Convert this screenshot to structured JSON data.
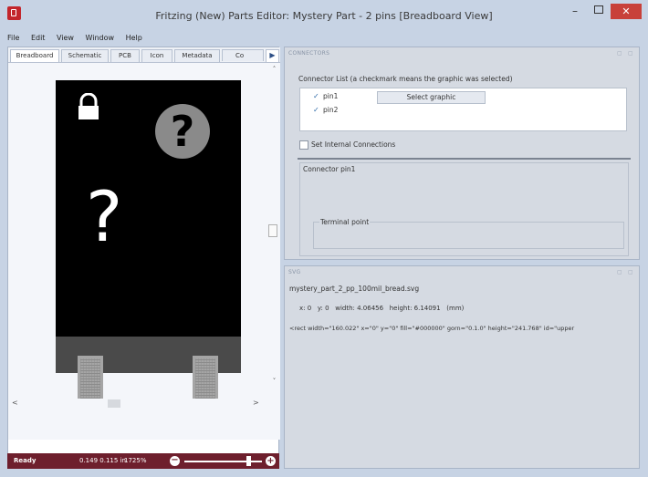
{
  "window": {
    "title": "Fritzing (New) Parts Editor: Mystery Part - 2 pins [Breadboard View]",
    "minimize_glyph": "–",
    "close_glyph": "✕"
  },
  "menubar": [
    "File",
    "Edit",
    "View",
    "Window",
    "Help"
  ],
  "tabs": [
    "Breadboard",
    "Schematic",
    "PCB",
    "Icon",
    "Metadata",
    "Connectors"
  ],
  "tabs_visible": [
    "Breadboard",
    "Schematic",
    "PCB",
    "Icon",
    "Metadata",
    "Co"
  ],
  "tab_scroll_glyph": "▶",
  "canvas": {
    "qmark_small": "?",
    "qmark_large": "?",
    "icons": [
      "lock-icon",
      "question-mark-icon"
    ],
    "vscroll_up": "˄",
    "vscroll_down": "˅",
    "hscroll_left": "<",
    "hscroll_right": ">"
  },
  "statusbar": {
    "status": "Ready",
    "coords": "0.149 0.115 in",
    "zoom": "1725%",
    "zoom_out": "−",
    "zoom_in": "+",
    "zoom_level_fraction": 0.84
  },
  "connectors_panel": {
    "title": "CONNECTORS",
    "list_label": "Connector List (a checkmark means the graphic was selected)",
    "connectors": [
      {
        "name": "pin1",
        "checked": "✓"
      },
      {
        "name": "pin2",
        "checked": "✓"
      }
    ],
    "select_graphic_label": "Select graphic",
    "internal_connections_label": "Set Internal Connections",
    "connector_group_label": "Connector pin1",
    "terminal_point_label": "Terminal point"
  },
  "svg_panel": {
    "title": "SVG",
    "filename": "mystery_part_2_pp_100mil_bread.svg",
    "x_label": "x: 0",
    "y_label": "y: 0",
    "width_label": "width: 4.06456",
    "height_label": "height: 6.14091",
    "units": "(mm)",
    "rect_line": "<rect width=\"160.022\" x=\"0\" y=\"0\" fill=\"#000000\" gorn=\"0.1.0\" height=\"241.768\" id=\"upper"
  },
  "colors": {
    "statusbar": "#6e1f2d",
    "close_button": "#c8413a",
    "part_body": "#000000",
    "pin": "#a5a5a5",
    "check": "#2f6aa8"
  }
}
